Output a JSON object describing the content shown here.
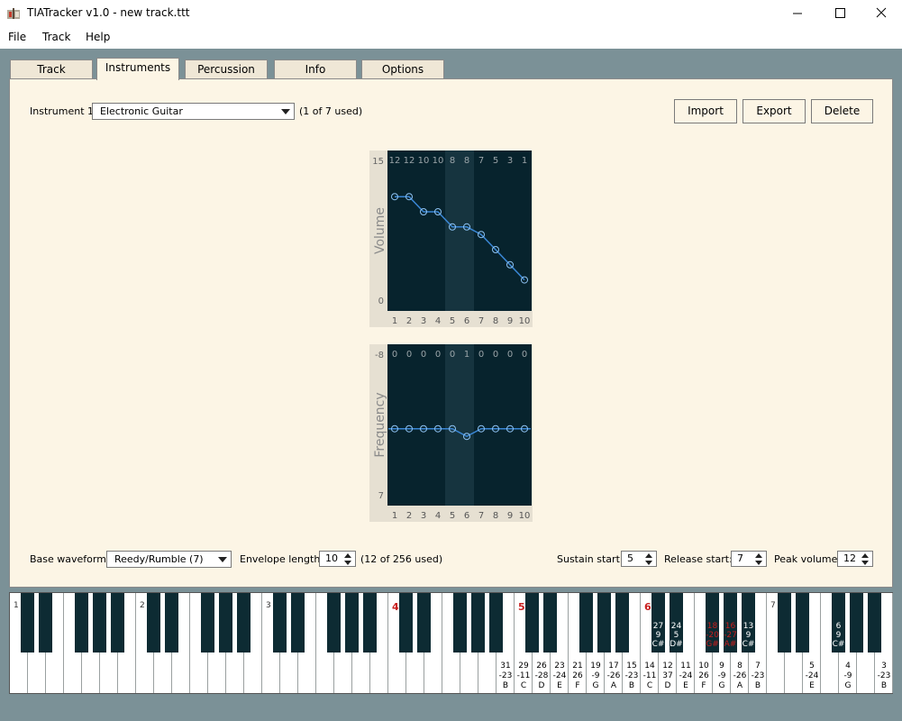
{
  "window": {
    "title": "TIATracker v1.0 - new track.ttt"
  },
  "menu": [
    "File",
    "Track",
    "Help"
  ],
  "tabs": [
    "Track",
    "Instruments",
    "Percussion",
    "Info",
    "Options"
  ],
  "instrument": {
    "label": "Instrument 1",
    "selected": "Electronic Guitar",
    "used": "(1 of 7 used)"
  },
  "buttons": {
    "import": "Import",
    "export": "Export",
    "delete": "Delete"
  },
  "volume_chart": {
    "ylabel": "Volume",
    "ymax_label": "15",
    "ymin_label": "0",
    "values": [
      12,
      12,
      10,
      10,
      8,
      8,
      7,
      5,
      3,
      1
    ],
    "x": [
      1,
      2,
      3,
      4,
      5,
      6,
      7,
      8,
      9,
      10
    ],
    "ymax": 15,
    "ymin": 0,
    "sustain_start": 5,
    "release_start": 7
  },
  "frequency_chart": {
    "ylabel": "Frequency",
    "ymax_label": "-8",
    "ymin_label": "7",
    "values": [
      0,
      0,
      0,
      0,
      0,
      1,
      0,
      0,
      0,
      0
    ],
    "x": [
      1,
      2,
      3,
      4,
      5,
      6,
      7,
      8,
      9,
      10
    ],
    "ymin": -8,
    "ymax": 7
  },
  "bottom": {
    "waveform_label": "Base waveform:",
    "waveform_value": "Reedy/Rumble (7)",
    "envelope_label": "Envelope length:",
    "envelope_value": "10",
    "envelope_used": "(12 of 256 used)",
    "sustain_label": "Sustain start:",
    "sustain_value": "5",
    "release_label": "Release start:",
    "release_value": "7",
    "peak_label": "Peak volume:",
    "peak_value": "12"
  },
  "keyboard": {
    "octaves": [
      "1",
      "2",
      "3",
      "4",
      "5",
      "6",
      "7"
    ],
    "black_labels": [
      {
        "key": 35,
        "lines": [
          "27",
          "9",
          "C#"
        ],
        "red": false
      },
      {
        "key": 36,
        "lines": [
          "24",
          "5",
          "D#"
        ],
        "red": false
      },
      {
        "key": 37,
        "lines": [
          "20",
          "7",
          "F#"
        ],
        "red": false
      },
      {
        "key": 38,
        "lines": [
          "18",
          "-20",
          "G#"
        ],
        "red": true
      },
      {
        "key": 39,
        "lines": [
          "16",
          "-27",
          "A#"
        ],
        "red": true
      },
      {
        "key": 40,
        "lines": [
          "13",
          "9",
          "C#"
        ],
        "red": false
      },
      {
        "key": 45,
        "lines": [
          "6",
          "9",
          "C#"
        ],
        "red": false
      }
    ],
    "white_labels": [
      {
        "key": 27,
        "lines": [
          "31",
          "-23",
          "B"
        ],
        "red": true
      },
      {
        "key": 28,
        "lines": [
          "29",
          "-11",
          "C"
        ],
        "red": true
      },
      {
        "key": 29,
        "lines": [
          "26",
          "-28",
          "D"
        ],
        "red": true
      },
      {
        "key": 30,
        "lines": [
          "23",
          "-24",
          "E"
        ],
        "red": true
      },
      {
        "key": 31,
        "lines": [
          "21",
          "26",
          "F"
        ],
        "red": true
      },
      {
        "key": 32,
        "lines": [
          "19",
          "-9",
          "G"
        ],
        "red": false
      },
      {
        "key": 33,
        "lines": [
          "17",
          "-26",
          "A"
        ],
        "red": true
      },
      {
        "key": 34,
        "lines": [
          "15",
          "-23",
          "B"
        ],
        "red": true
      },
      {
        "key": 35,
        "lines": [
          "14",
          "-11",
          "C"
        ],
        "red": true
      },
      {
        "key": 36,
        "lines": [
          "12",
          "37",
          "D"
        ],
        "red": true
      },
      {
        "key": 37,
        "lines": [
          "11",
          "-24",
          "E"
        ],
        "red": true
      },
      {
        "key": 38,
        "lines": [
          "10",
          "26",
          "F"
        ],
        "red": true
      },
      {
        "key": 39,
        "lines": [
          "9",
          "-9",
          "G"
        ],
        "red": false
      },
      {
        "key": 40,
        "lines": [
          "8",
          "-26",
          "A"
        ],
        "red": true
      },
      {
        "key": 41,
        "lines": [
          "7",
          "-23",
          "B"
        ],
        "red": true
      },
      {
        "key": 44,
        "lines": [
          "5",
          "-24",
          "E"
        ],
        "red": true
      },
      {
        "key": 46,
        "lines": [
          "4",
          "-9",
          "G"
        ],
        "red": false
      },
      {
        "key": 48,
        "lines": [
          "3",
          "-23",
          "B"
        ],
        "red": true
      }
    ]
  },
  "colors": {
    "accent": "#3a86d4",
    "chart_bg": "#07232d",
    "chart_band": "#16343f",
    "panel": "#fcf5e5",
    "frame": "#7b9197",
    "red": "#c81e1e"
  }
}
